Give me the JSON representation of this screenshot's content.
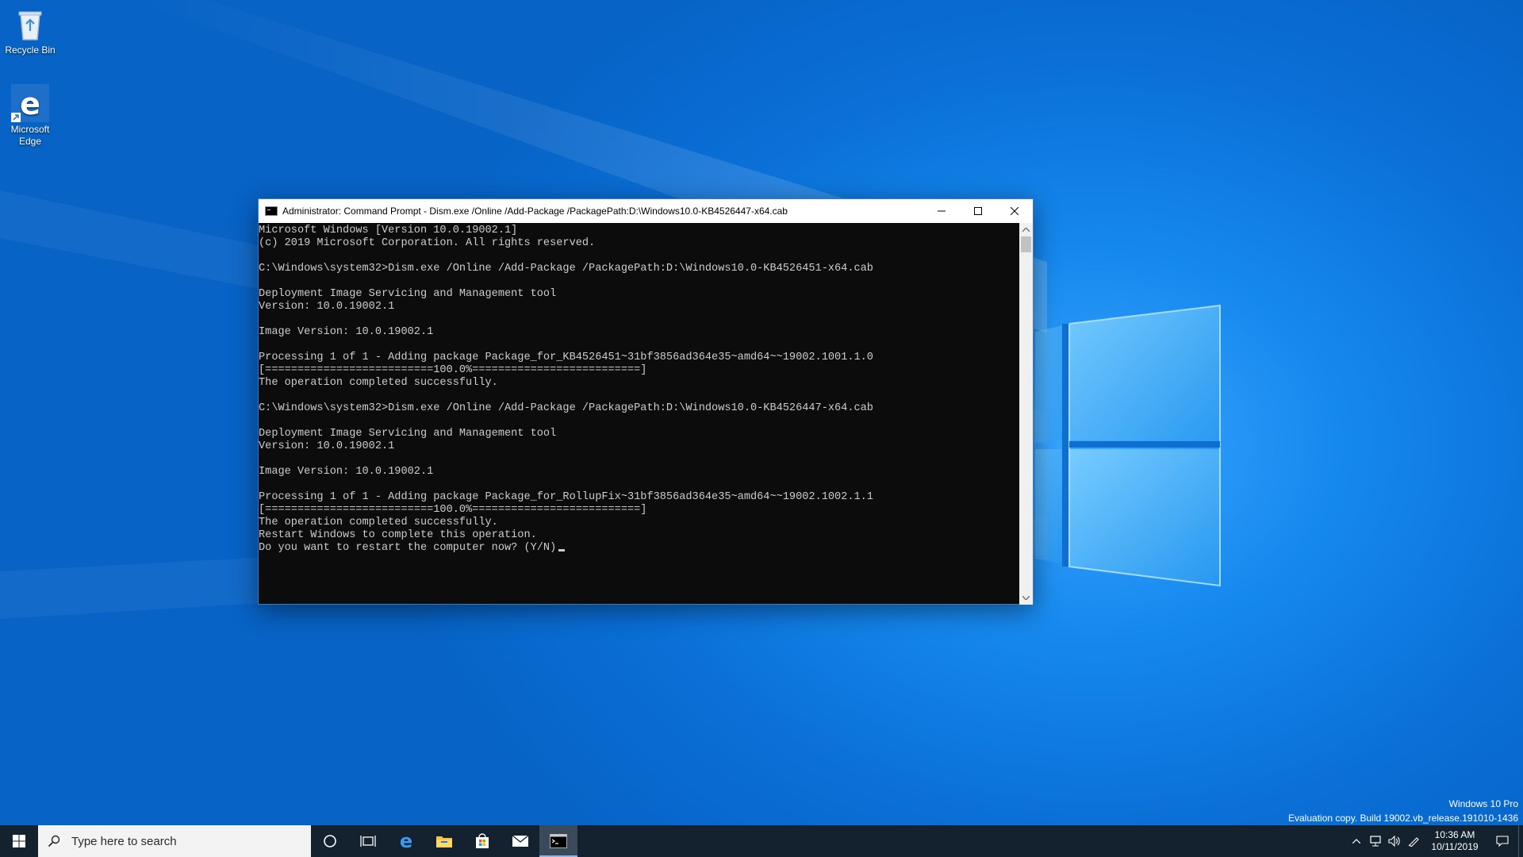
{
  "desktop": {
    "icons": [
      {
        "label": "Recycle Bin",
        "icon": "recycle-bin-icon"
      },
      {
        "label": "Microsoft Edge",
        "icon": "edge-icon"
      }
    ],
    "watermark": {
      "edition": "Windows 10 Pro",
      "build": "Evaluation copy. Build 19002.vb_release.191010-1436"
    }
  },
  "window": {
    "title": "Administrator: Command Prompt - Dism.exe  /Online /Add-Package /PackagePath:D:\\Windows10.0-KB4526447-x64.cab",
    "minimize_label": "Minimize",
    "maximize_label": "Maximize",
    "close_label": "Close",
    "console_lines": [
      "Microsoft Windows [Version 10.0.19002.1]",
      "(c) 2019 Microsoft Corporation. All rights reserved.",
      "",
      "C:\\Windows\\system32>Dism.exe /Online /Add-Package /PackagePath:D:\\Windows10.0-KB4526451-x64.cab",
      "",
      "Deployment Image Servicing and Management tool",
      "Version: 10.0.19002.1",
      "",
      "Image Version: 10.0.19002.1",
      "",
      "Processing 1 of 1 - Adding package Package_for_KB4526451~31bf3856ad364e35~amd64~~19002.1001.1.0",
      "[==========================100.0%==========================]",
      "The operation completed successfully.",
      "",
      "C:\\Windows\\system32>Dism.exe /Online /Add-Package /PackagePath:D:\\Windows10.0-KB4526447-x64.cab",
      "",
      "Deployment Image Servicing and Management tool",
      "Version: 10.0.19002.1",
      "",
      "Image Version: 10.0.19002.1",
      "",
      "Processing 1 of 1 - Adding package Package_for_RollupFix~31bf3856ad364e35~amd64~~19002.1002.1.1",
      "[==========================100.0%==========================]",
      "The operation completed successfully.",
      "Restart Windows to complete this operation.",
      "Do you want to restart the computer now? (Y/N)"
    ]
  },
  "taskbar": {
    "search_placeholder": "Type here to search",
    "pinned": [
      "cortana-icon",
      "task-view-icon",
      "edge-icon",
      "file-explorer-icon",
      "store-icon",
      "mail-icon",
      "command-prompt-icon"
    ],
    "active_app": "command-prompt-icon",
    "clock_time": "10:36 AM",
    "clock_date": "10/11/2019"
  },
  "colors": {
    "wallpaper": "#0a7ad6",
    "taskbar": "#14212e",
    "console_bg": "#0c0c0c",
    "console_text": "#cccccc"
  }
}
